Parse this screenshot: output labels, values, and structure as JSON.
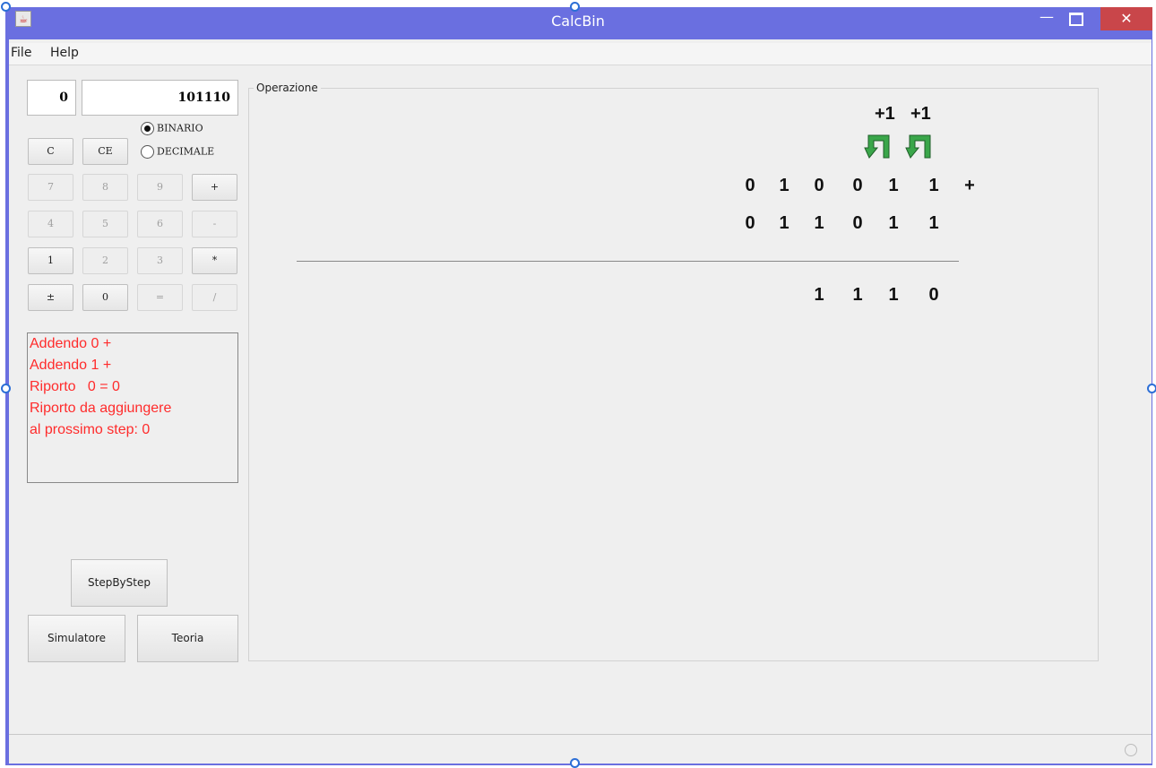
{
  "window": {
    "title": "CalcBin"
  },
  "menu": {
    "items": [
      "File",
      "Help"
    ]
  },
  "display": {
    "left_value": "0",
    "main_value": "101110"
  },
  "mode": {
    "options": [
      "BINARIO",
      "DECIMALE"
    ],
    "selected": "BINARIO"
  },
  "keys": {
    "c": "C",
    "ce": "CE",
    "k7": "7",
    "k8": "8",
    "k9": "9",
    "plus": "+",
    "k4": "4",
    "k5": "5",
    "k6": "6",
    "minus": "-",
    "k1": "1",
    "k2": "2",
    "k3": "3",
    "mul": "*",
    "sign": "±",
    "k0": "0",
    "eq": "=",
    "div": "/"
  },
  "info": {
    "lines": [
      "Addendo 0 +",
      "Addendo 1 +",
      "Riporto   0 = 0",
      "",
      "Riporto da aggiungere",
      "al prossimo step: 0"
    ]
  },
  "buttons": {
    "step": "StepByStep",
    "simulator": "Simulatore",
    "theory": "Teoria"
  },
  "operation": {
    "panel_title": "Operazione",
    "carries": [
      "+1",
      "+1"
    ],
    "row1": [
      "0",
      "1",
      "0",
      "0",
      "1",
      "1"
    ],
    "operator": "+",
    "row2": [
      "0",
      "1",
      "1",
      "0",
      "1",
      "1"
    ],
    "result": [
      "1",
      "1",
      "1",
      "0"
    ]
  },
  "colors": {
    "title_bar": "#6a6fe0",
    "close": "#c9464a",
    "info_text": "#ff2b2b",
    "arrow": "#3aa64a"
  }
}
